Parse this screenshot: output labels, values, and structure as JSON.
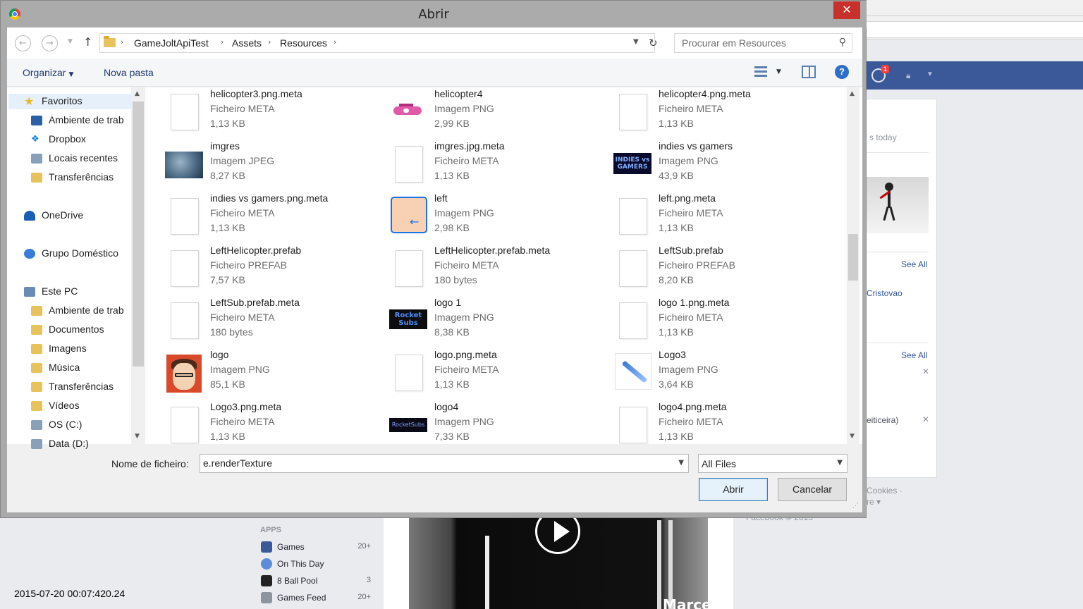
{
  "dialog": {
    "title": "Abrir",
    "close_label": "✕",
    "breadcrumbs": [
      "GameJoltApiTest",
      "Assets",
      "Resources"
    ],
    "search_placeholder": "Procurar em Resources",
    "toolbar": {
      "organize": "Organizar",
      "new_folder": "Nova pasta",
      "help": "?"
    },
    "nav": {
      "favorites": "Favoritos",
      "fav_items": [
        "Ambiente de trab",
        "Dropbox",
        "Locais recentes",
        "Transferências"
      ],
      "onedrive": "OneDrive",
      "homegroup": "Grupo Doméstico",
      "this_pc": "Este PC",
      "pc_items": [
        "Ambiente de trab",
        "Documentos",
        "Imagens",
        "Música",
        "Transferências",
        "Vídeos",
        "OS (C:)",
        "Data (D:)"
      ]
    },
    "files": [
      {
        "name": "helicopter3.png.meta",
        "type": "Ficheiro META",
        "size": "1,13 KB",
        "icon": "document-icon"
      },
      {
        "name": "helicopter4",
        "type": "Imagem PNG",
        "size": "2,99 KB",
        "icon": "helicopter-thumbnail"
      },
      {
        "name": "helicopter4.png.meta",
        "type": "Ficheiro META",
        "size": "1,13 KB",
        "icon": "document-icon"
      },
      {
        "name": "imgres",
        "type": "Imagem JPEG",
        "size": "8,27 KB",
        "icon": "imgres-thumbnail"
      },
      {
        "name": "imgres.jpg.meta",
        "type": "Ficheiro META",
        "size": "1,13 KB",
        "icon": "document-icon"
      },
      {
        "name": "indies vs gamers",
        "type": "Imagem PNG",
        "size": "43,9 KB",
        "icon": "indies-thumbnail"
      },
      {
        "name": "indies vs gamers.png.meta",
        "type": "Ficheiro META",
        "size": "1,13 KB",
        "icon": "document-icon"
      },
      {
        "name": "left",
        "type": "Imagem PNG",
        "size": "2,98 KB",
        "icon": "left-arrow-thumbnail"
      },
      {
        "name": "left.png.meta",
        "type": "Ficheiro META",
        "size": "1,13 KB",
        "icon": "document-icon"
      },
      {
        "name": "LeftHelicopter.prefab",
        "type": "Ficheiro PREFAB",
        "size": "7,57 KB",
        "icon": "document-icon"
      },
      {
        "name": "LeftHelicopter.prefab.meta",
        "type": "Ficheiro META",
        "size": "180 bytes",
        "icon": "document-icon"
      },
      {
        "name": "LeftSub.prefab",
        "type": "Ficheiro PREFAB",
        "size": "8,20 KB",
        "icon": "document-icon"
      },
      {
        "name": "LeftSub.prefab.meta",
        "type": "Ficheiro META",
        "size": "180 bytes",
        "icon": "document-icon"
      },
      {
        "name": "logo 1",
        "type": "Imagem PNG",
        "size": "8,38 KB",
        "icon": "logo1-thumbnail"
      },
      {
        "name": "logo 1.png.meta",
        "type": "Ficheiro META",
        "size": "1,13 KB",
        "icon": "document-icon"
      },
      {
        "name": "logo",
        "type": "Imagem PNG",
        "size": "85,1 KB",
        "icon": "face-thumbnail"
      },
      {
        "name": "logo.png.meta",
        "type": "Ficheiro META",
        "size": "1,13 KB",
        "icon": "document-icon"
      },
      {
        "name": "Logo3",
        "type": "Imagem PNG",
        "size": "3,64 KB",
        "icon": "sword-thumbnail"
      },
      {
        "name": "Logo3.png.meta",
        "type": "Ficheiro META",
        "size": "1,13 KB",
        "icon": "document-icon"
      },
      {
        "name": "logo4",
        "type": "Imagem PNG",
        "size": "7,33 KB",
        "icon": "logo4-thumbnail"
      },
      {
        "name": "logo4.png.meta",
        "type": "Ficheiro META",
        "size": "1,13 KB",
        "icon": "document-icon"
      }
    ],
    "thumb_text": {
      "indies": "INDIES vs GAMERS",
      "logo1": "Rocket Subs",
      "logo4": "RocketSubs"
    },
    "filename_label": "Nome de ficheiro:",
    "filename_value": "e.renderTexture",
    "filter_value": "All Files",
    "open_button": "Abrir",
    "cancel_button": "Cancelar"
  },
  "background": {
    "notif_count": "1",
    "today_text": "s today",
    "see_all": "See All",
    "friend_name": "Cristovao",
    "feiticeira": "eiticeira)",
    "cookies": "Cookies ·",
    "more": "re ▾",
    "copyright": "Facebook © 2015",
    "apps_label": "APPS",
    "apps": [
      {
        "name": "Games",
        "count": "20+"
      },
      {
        "name": "On This Day",
        "count": ""
      },
      {
        "name": "8 Ball Pool",
        "count": "3"
      },
      {
        "name": "Games Feed",
        "count": "20+"
      }
    ],
    "video_watermark": "Marcel",
    "timestamp": "2015-07-20 00:07:420.24"
  }
}
